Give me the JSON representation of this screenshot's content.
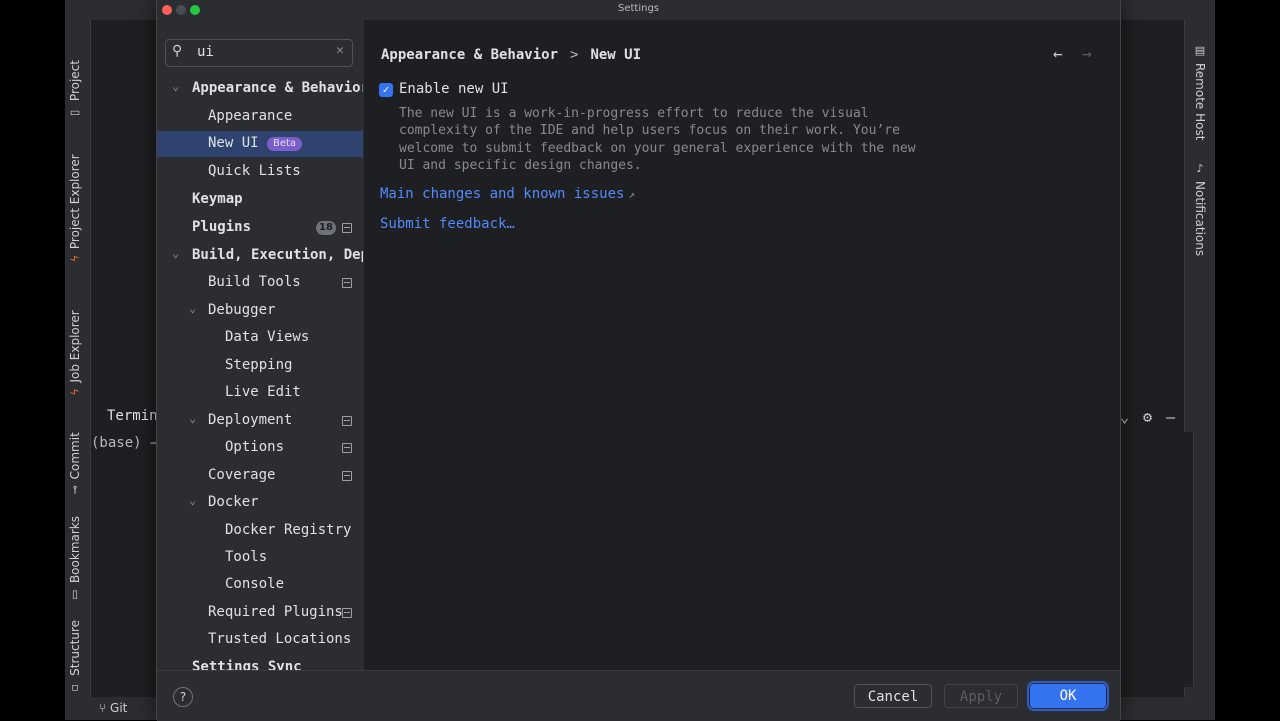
{
  "background": {
    "left_tools": [
      "Project",
      "Project Explorer",
      "Job Explorer",
      "Commit",
      "Bookmarks",
      "Structure"
    ],
    "right_tools": [
      "Remote Host",
      "Notifications"
    ],
    "terminal_title": "Termin",
    "terminal_prompt": "(base) →",
    "status_git": "Git"
  },
  "dialog": {
    "title": "Settings",
    "search": {
      "value": "ui"
    },
    "tree": [
      {
        "label": "Appearance & Behavior",
        "bold": true,
        "expanded": true
      },
      {
        "label": "Appearance"
      },
      {
        "label": "New UI",
        "selected": true,
        "badge": "Beta"
      },
      {
        "label": "Quick Lists"
      },
      {
        "label": "Keymap",
        "bold": true
      },
      {
        "label": "Plugins",
        "bold": true,
        "count": "18"
      },
      {
        "label": "Build, Execution, Deployment",
        "bold": true,
        "expanded": true
      },
      {
        "label": "Build Tools"
      },
      {
        "label": "Debugger",
        "expanded": true
      },
      {
        "label": "Data Views"
      },
      {
        "label": "Stepping"
      },
      {
        "label": "Live Edit"
      },
      {
        "label": "Deployment",
        "expanded": true
      },
      {
        "label": "Options"
      },
      {
        "label": "Coverage"
      },
      {
        "label": "Docker",
        "expanded": true
      },
      {
        "label": "Docker Registry"
      },
      {
        "label": "Tools"
      },
      {
        "label": "Console"
      },
      {
        "label": "Required Plugins"
      },
      {
        "label": "Trusted Locations"
      },
      {
        "label": "Settings Sync",
        "bold": true
      }
    ],
    "breadcrumb": [
      "Appearance & Behavior",
      "New UI"
    ],
    "breadcrumb_sep": ">",
    "enable_checkbox": {
      "label": "Enable new UI",
      "checked": true
    },
    "description": "The new UI is a work-in-progress effort to reduce the visual complexity of the IDE and help users focus on their work. You’re welcome to submit feedback on your general experience with the new UI and specific design changes.",
    "links": {
      "main_changes": "Main changes and known issues",
      "submit_feedback": "Submit feedback…"
    },
    "buttons": {
      "help": "?",
      "cancel": "Cancel",
      "apply": "Apply",
      "ok": "OK"
    }
  },
  "colors": {
    "accent": "#3574f0",
    "selection": "#2e436e",
    "link": "#548af7",
    "beta_badge": "#7b5ec9"
  }
}
